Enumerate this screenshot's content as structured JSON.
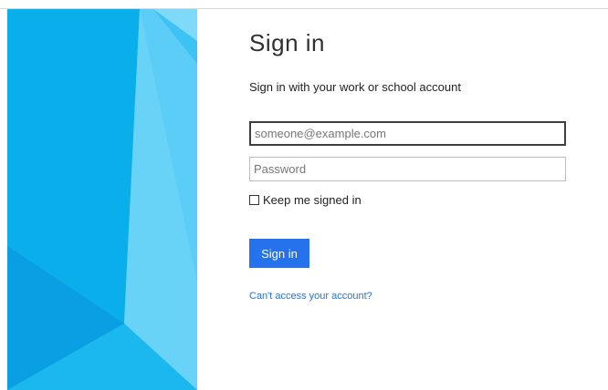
{
  "brand_colors": {
    "accent": "#2672ec",
    "panel_light": "#5bc8f5",
    "panel_mid": "#27b2ec",
    "panel_dark": "#0c9fe0"
  },
  "signin": {
    "title": "Sign in",
    "subtitle": "Sign in with your work or school account",
    "email_placeholder": "someone@example.com",
    "password_placeholder": "Password",
    "keep_signed_in": "Keep me signed in",
    "keep_signed_in_checked": false,
    "submit_label": "Sign in",
    "help_link": "Can't access your account?"
  }
}
